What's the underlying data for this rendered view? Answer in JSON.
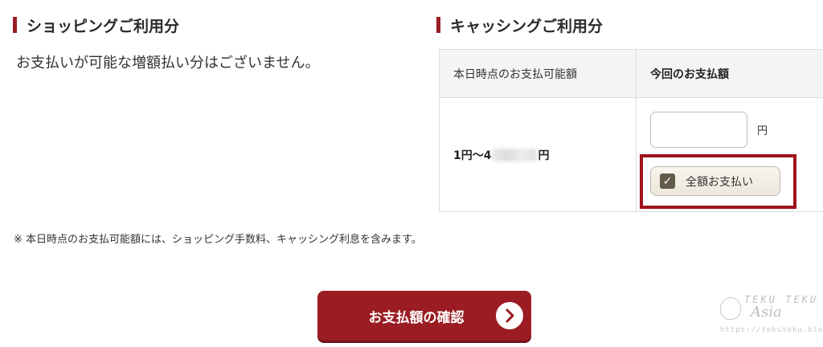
{
  "shopping": {
    "title": "ショッピングご利用分",
    "message": "お支払いが可能な増額払い分はございません。"
  },
  "cashing": {
    "title": "キャッシングご利用分",
    "table": {
      "col1_header": "本日時点のお支払可能額",
      "col2_header": "今回のお支払額",
      "range_prefix": "1円〜4",
      "range_suffix": "円",
      "amount_value": "",
      "yen_unit": "円",
      "full_payment_label": "全額お支払い",
      "full_payment_checked": true
    }
  },
  "note": "※ 本日時点のお支払可能額には、ショッピング手数料、キャッシング利息を含みます。",
  "confirm_button": {
    "label": "お支払額の確認"
  },
  "watermark": {
    "line1": "TEKU TEKU",
    "line2": "Asia",
    "url": "https://tekuteku.blog/"
  },
  "colors": {
    "accent": "#9b1c23",
    "checkbox": "#625a4a",
    "highlight": "#a0121c"
  },
  "icons": {
    "checkbox": "checkmark-icon",
    "confirm": "chevron-right-icon"
  }
}
